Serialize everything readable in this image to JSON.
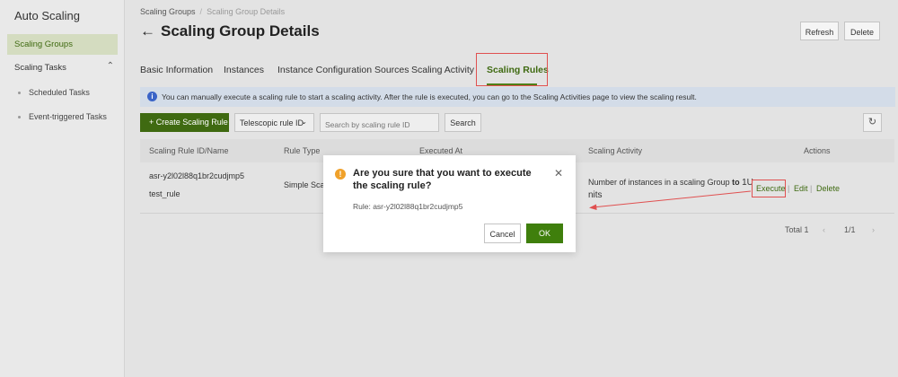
{
  "sidebar": {
    "title": "Auto Scaling",
    "active_item": "Scaling Groups",
    "group_label": "Scaling Tasks",
    "group_chevron": "⌃",
    "sub_items": [
      "Scheduled Tasks",
      "Event-triggered Tasks"
    ]
  },
  "header": {
    "breadcrumb": [
      "Scaling Groups",
      "Scaling Group Details"
    ],
    "breadcrumb_sep": "/",
    "title": "Scaling Group Details",
    "back_arrow": "←",
    "refresh_label": "Refresh",
    "delete_label": "Delete"
  },
  "tabs": [
    "Basic Information",
    "Instances",
    "Instance Configuration Sources",
    "Scaling Activity",
    "Scaling Rules"
  ],
  "active_tab": "Scaling Rules",
  "notice": {
    "icon": "i",
    "text": "You can manually execute a scaling rule to start a scaling activity. After the rule is executed, you can go to the Scaling Activities page to view the scaling result."
  },
  "toolbar": {
    "create_label": "+ Create Scaling Rule",
    "filter_value": "Telescopic rule ID",
    "filter_caret": "⌄",
    "search_placeholder": "Search by scaling rule ID",
    "search_label": "Search",
    "refresh_icon": "↻"
  },
  "table": {
    "headers": [
      "Scaling Rule ID/Name",
      "Rule Type",
      "Executed At",
      "Scaling Activity",
      "Actions"
    ],
    "row": {
      "id": "asr-y2l02l88q1br2cudjmp5",
      "name": "test_rule",
      "type": "Simple Scali",
      "activity_prefix": "Number of instances in a scaling Group",
      "activity_bold": "to",
      "activity_suffix_1": "1U",
      "activity_suffix_2": "nits",
      "actions": [
        "Execute",
        "Edit",
        "Delete"
      ],
      "action_sep": "|"
    }
  },
  "pagination": {
    "total": "Total 1",
    "prev": "‹",
    "page": "1/1",
    "next": "›"
  },
  "modal": {
    "icon": "!",
    "title": "Are you sure that you want to execute the scaling rule?",
    "close": "✕",
    "rule_text": "Rule: asr-y2l02l88q1br2cudjmp5",
    "cancel_label": "Cancel",
    "ok_label": "OK"
  },
  "colors": {
    "accent": "#3f6a11",
    "highlight_border": "#e05050",
    "warning": "#f0a12a",
    "info": "#3a63c7"
  }
}
